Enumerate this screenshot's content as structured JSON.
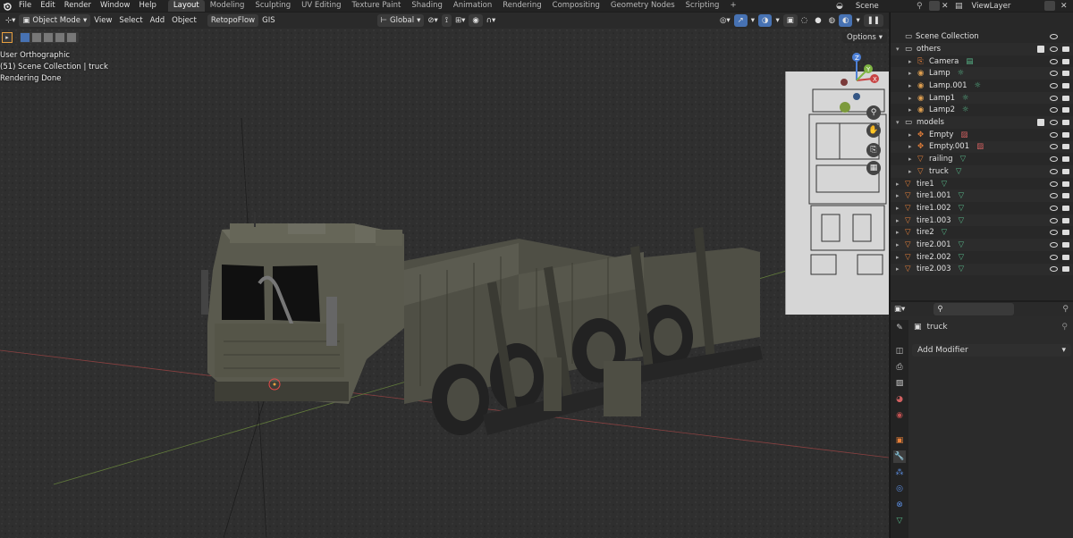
{
  "menus": [
    "File",
    "Edit",
    "Render",
    "Window",
    "Help"
  ],
  "workspaces": [
    "Layout",
    "Modeling",
    "Sculpting",
    "UV Editing",
    "Texture Paint",
    "Shading",
    "Animation",
    "Rendering",
    "Compositing",
    "Geometry Nodes",
    "Scripting"
  ],
  "active_workspace": "Layout",
  "scene_name": "Scene",
  "view_layer": "ViewLayer",
  "viewport_header": {
    "mode": "Object Mode",
    "menus": [
      "View",
      "Select",
      "Add",
      "Object"
    ],
    "addons": [
      "RetopoFlow",
      "GIS"
    ],
    "orientation": "Global",
    "options_label": "Options"
  },
  "viewport_overlay": {
    "view_name": "User Orthographic",
    "collection_info": "(51) Scene Collection | truck",
    "status": "Rendering Done"
  },
  "outliner": {
    "root": "Scene Collection",
    "rows": [
      {
        "label": "others",
        "type": "collection",
        "indent": 1
      },
      {
        "label": "Camera",
        "type": "camera",
        "indent": 2
      },
      {
        "label": "Lamp",
        "type": "lamp",
        "indent": 2
      },
      {
        "label": "Lamp.001",
        "type": "lamp",
        "indent": 2
      },
      {
        "label": "Lamp1",
        "type": "lamp",
        "indent": 2
      },
      {
        "label": "Lamp2",
        "type": "lamp",
        "indent": 2
      },
      {
        "label": "models",
        "type": "collection",
        "indent": 1
      },
      {
        "label": "Empty",
        "type": "empty",
        "indent": 2
      },
      {
        "label": "Empty.001",
        "type": "empty",
        "indent": 2
      },
      {
        "label": "railing",
        "type": "mesh",
        "indent": 2
      },
      {
        "label": "truck",
        "type": "mesh",
        "indent": 2
      },
      {
        "label": "tire1",
        "type": "mesh",
        "indent": 1
      },
      {
        "label": "tire1.001",
        "type": "mesh",
        "indent": 1
      },
      {
        "label": "tire1.002",
        "type": "mesh",
        "indent": 1
      },
      {
        "label": "tire1.003",
        "type": "mesh",
        "indent": 1
      },
      {
        "label": "tire2",
        "type": "mesh",
        "indent": 1
      },
      {
        "label": "tire2.001",
        "type": "mesh",
        "indent": 1
      },
      {
        "label": "tire2.002",
        "type": "mesh",
        "indent": 1
      },
      {
        "label": "tire2.003",
        "type": "mesh",
        "indent": 1
      }
    ]
  },
  "properties": {
    "object_name": "truck",
    "add_modifier_label": "Add Modifier"
  },
  "colors": {
    "accent_blue": "#4772b3",
    "mesh_green": "#58b88a",
    "lamp_orange": "#e0a050",
    "object_orange": "#e8813a",
    "x_axis": "#c84343",
    "y_axis": "#7fb443",
    "z_axis": "#4d80d6"
  }
}
